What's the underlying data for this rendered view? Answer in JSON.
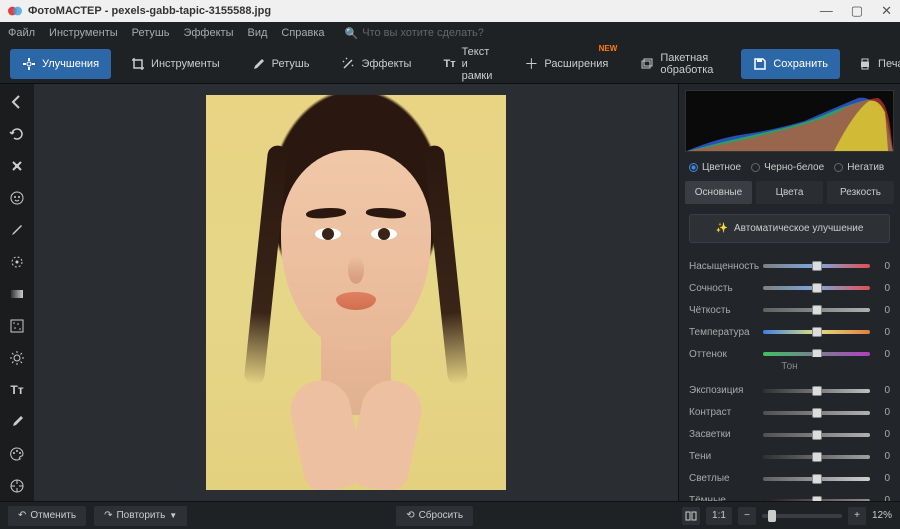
{
  "titlebar": {
    "app": "ФотоМАСТЕР",
    "file": "pexels-gabb-tapic-3155588.jpg"
  },
  "menubar": {
    "items": [
      "Файл",
      "Инструменты",
      "Ретушь",
      "Эффекты",
      "Вид",
      "Справка"
    ],
    "search_hint": "Что вы хотите сделать?"
  },
  "toolbar": {
    "tabs": [
      {
        "label": "Улучшения",
        "active": true
      },
      {
        "label": "Инструменты"
      },
      {
        "label": "Ретушь"
      },
      {
        "label": "Эффекты"
      },
      {
        "label": "Текст и рамки"
      },
      {
        "label": "Расширения",
        "new": "NEW"
      },
      {
        "label": "Пакетная обработка"
      }
    ],
    "save": "Сохранить",
    "print": "Печать"
  },
  "mode_row": {
    "color": "Цветное",
    "bw": "Черно-белое",
    "neg": "Негатив"
  },
  "subtabs": [
    "Основные",
    "Цвета",
    "Резкость"
  ],
  "auto_btn": "Автоматическое улучшение",
  "section_tone": "Тон",
  "sliders": {
    "color": [
      {
        "label": "Насыщенность",
        "value": "0",
        "gradient": "linear-gradient(90deg,#808080,#7aa8e0,#e05050)"
      },
      {
        "label": "Сочность",
        "value": "0",
        "gradient": "linear-gradient(90deg,#808080,#7aa8e0,#e05050)"
      },
      {
        "label": "Чёткость",
        "value": "0",
        "gradient": "linear-gradient(90deg,#606060,#b0b0b0)"
      },
      {
        "label": "Температура",
        "value": "0",
        "gradient": "linear-gradient(90deg,#4080e0,#e0e080,#e08040)"
      },
      {
        "label": "Оттенок",
        "value": "0",
        "gradient": "linear-gradient(90deg,#40c060,#b040c0)"
      }
    ],
    "tone": [
      {
        "label": "Экспозиция",
        "value": "0",
        "gradient": "linear-gradient(90deg,#303030,#c0c0c0)"
      },
      {
        "label": "Контраст",
        "value": "0",
        "gradient": "linear-gradient(90deg,#505050,#b0b0b0)"
      },
      {
        "label": "Засветки",
        "value": "0",
        "gradient": "linear-gradient(90deg,#505050,#b0b0b0)"
      },
      {
        "label": "Тени",
        "value": "0",
        "gradient": "linear-gradient(90deg,#303030,#a0a0a0)"
      },
      {
        "label": "Светлые",
        "value": "0",
        "gradient": "linear-gradient(90deg,#606060,#d0d0d0)"
      },
      {
        "label": "Тёмные",
        "value": "0",
        "gradient": "linear-gradient(90deg,#202020,#909090)"
      }
    ]
  },
  "bottombar": {
    "undo": "Отменить",
    "redo": "Повторить",
    "reset": "Сбросить",
    "fit": "1:1",
    "zoom_pct": "12%"
  }
}
